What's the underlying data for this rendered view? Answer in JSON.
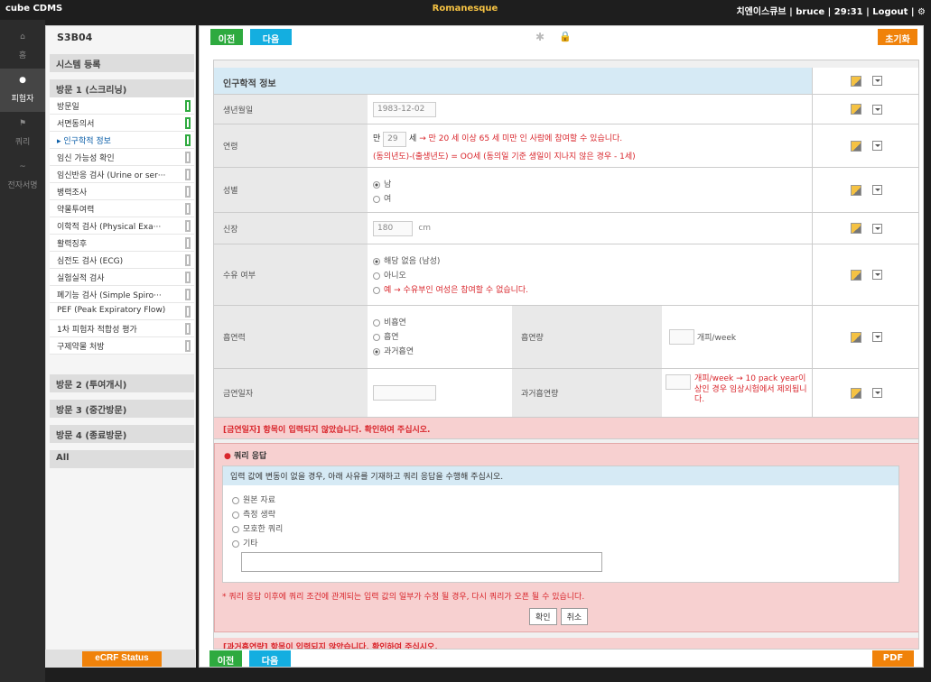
{
  "topbar": {
    "app_name": "cube CDMS",
    "study": "Romanesque",
    "user_info": "치엔이스큐브 | bruce | 29:31 | Logout |"
  },
  "leftnav": [
    {
      "label": "홈"
    },
    {
      "label": "피험자"
    },
    {
      "label": "쿼리"
    },
    {
      "label": "전자서명"
    }
  ],
  "sidebar": {
    "subject_id": "S3B04",
    "system_reg": "시스템 등록",
    "visit1": "방문 1 (스크리닝)",
    "items": [
      {
        "label": "방문일"
      },
      {
        "label": "서면동의서"
      },
      {
        "label": "▸ 인구학적 정보"
      },
      {
        "label": "임신 가능성 확인"
      },
      {
        "label": "임신반응 검사 (Urine or ser···"
      },
      {
        "label": "병력조사"
      },
      {
        "label": "약물투여력"
      },
      {
        "label": "이학적 검사 (Physical Exa···"
      },
      {
        "label": "활력징후"
      },
      {
        "label": "심전도 검사 (ECG)"
      },
      {
        "label": "실험실적 검사"
      },
      {
        "label": "폐기능 검사 (Simple Spiro···"
      },
      {
        "label": "PEF (Peak Expiratory Flow)"
      },
      {
        "label": "1차 피험자 적합성 평가"
      },
      {
        "label": "구제약물 처방"
      }
    ],
    "visit2": "방문 2 (투여개시)",
    "visit3": "방문 3 (중간방문)",
    "visit4": "방문 4 (종료방문)",
    "all": "All",
    "ecrf_status": "eCRF Status"
  },
  "toolbar": {
    "prev": "이전",
    "next": "다음",
    "reset": "초기화",
    "pdf": "PDF"
  },
  "form": {
    "section_title": "인구학적 정보",
    "birth_label": "생년월일",
    "birth_value": "1983-12-02",
    "age_label": "연령",
    "age_prefix": "만",
    "age_value": "29",
    "age_suffix": "세",
    "age_note1": "→ 만 20 세 이상 65 세 미만 인 사람에 참여할 수 있습니다.",
    "age_note2": "(동의년도)-(출생년도) = OO세 (동의일 기준 생일이 지나지 않은 경우 - 1세)",
    "sex_label": "성별",
    "sex_m": "남",
    "sex_f": "여",
    "height_label": "신장",
    "height_value": "180",
    "height_unit": "cm",
    "lact_label": "수유 여부",
    "lact_opt1": "해당 없음 (남성)",
    "lact_opt2": "아니오",
    "lact_opt3": "예 → 수유부인 여성은 참여할 수 없습니다.",
    "smoke_label": "흡연력",
    "smoke_opt1": "비흡연",
    "smoke_opt2": "흡연",
    "smoke_opt3": "과거흡연",
    "smoke_amt_label": "흡연량",
    "smoke_amt_unit": "개피/week",
    "quit_label": "금연일자",
    "past_amt_label": "과거흡연량",
    "past_amt_note": "개피/week → 10 pack year이상인 경우 임상시험에서 제외됩니다.",
    "warning": "[금연일자] 항목이 입력되지 않았습니다. 확인하여 주십시오.",
    "query_title": "쿼리 응답",
    "query_instruction": "입력 값에 변동이 없을 경우, 아래 사유를 기재하고 쿼리 응답을 수행해 주십시오.",
    "q_opt1": "원본 자료",
    "q_opt2": "측정 생략",
    "q_opt3": "모호한 쿼리",
    "q_opt4": "기타",
    "query_note": "* 쿼리 응답 이후에 쿼리 조건에 관계되는 입력 값의 일부가 수정 될 경우, 다시 쿼리가 오픈 될 수 있습니다.",
    "confirm": "확인",
    "cancel": "취소",
    "cut_warning": "[과거흡연량] 항목이 입력되지 않았습니다. 확인하여 주십시오."
  }
}
